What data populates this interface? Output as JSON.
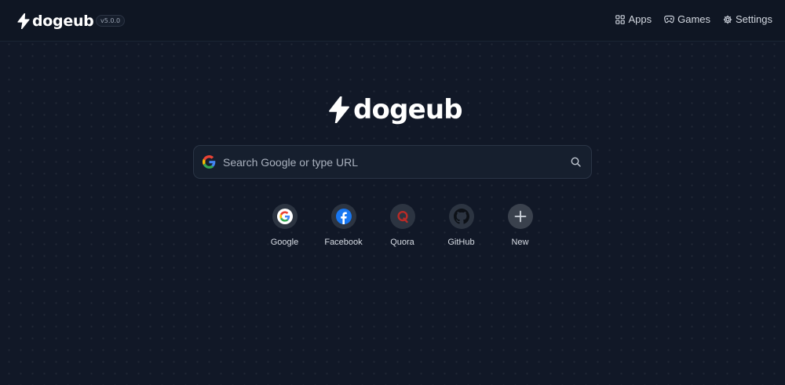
{
  "header": {
    "brand": "dogeub",
    "version": "v5.0.0",
    "nav": [
      {
        "label": "Apps",
        "icon": "grid-icon"
      },
      {
        "label": "Games",
        "icon": "gamepad-icon"
      },
      {
        "label": "Settings",
        "icon": "gear-icon"
      }
    ]
  },
  "hero": {
    "brand": "dogeub"
  },
  "search": {
    "placeholder": "Search Google or type URL",
    "value": ""
  },
  "shortcuts": [
    {
      "label": "Google",
      "icon": "google-icon"
    },
    {
      "label": "Facebook",
      "icon": "facebook-icon"
    },
    {
      "label": "Quora",
      "icon": "quora-icon"
    },
    {
      "label": "GitHub",
      "icon": "github-icon"
    },
    {
      "label": "New",
      "icon": "plus-icon"
    }
  ],
  "colors": {
    "background": "#111827",
    "topbar": "#0f1623",
    "text": "#e6e9ef",
    "facebook": "#1877f2",
    "quora": "#b92b27"
  }
}
